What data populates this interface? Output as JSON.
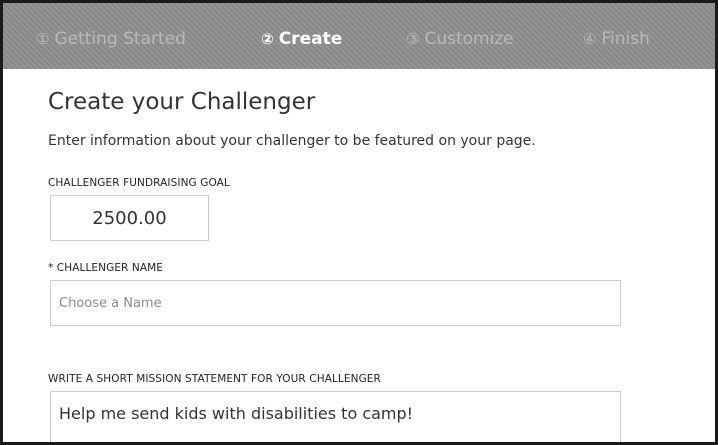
{
  "steps": [
    {
      "number": "①",
      "label": "Getting Started",
      "active": false
    },
    {
      "number": "②",
      "label": "Create",
      "active": true
    },
    {
      "number": "③",
      "label": "Customize",
      "active": false
    },
    {
      "number": "④",
      "label": "Finish",
      "active": false
    }
  ],
  "page": {
    "title": "Create your Challenger",
    "intro": "Enter information about your challenger to be featured on your page."
  },
  "fields": {
    "goal": {
      "label": "CHALLENGER FUNDRAISING GOAL",
      "value": "2500.00"
    },
    "name": {
      "label": "* CHALLENGER NAME",
      "value": "",
      "placeholder": "Choose a Name"
    },
    "mission": {
      "label": "WRITE A SHORT MISSION STATEMENT FOR YOUR CHALLENGER",
      "value": "Help me send kids with disabilities to camp!"
    }
  },
  "colors": {
    "steps_bar_bg": "#8e8e8e",
    "step_active": "#ffffff",
    "step_inactive": "#b9b9b9",
    "text": "#333333",
    "input_border": "#cccccc"
  }
}
